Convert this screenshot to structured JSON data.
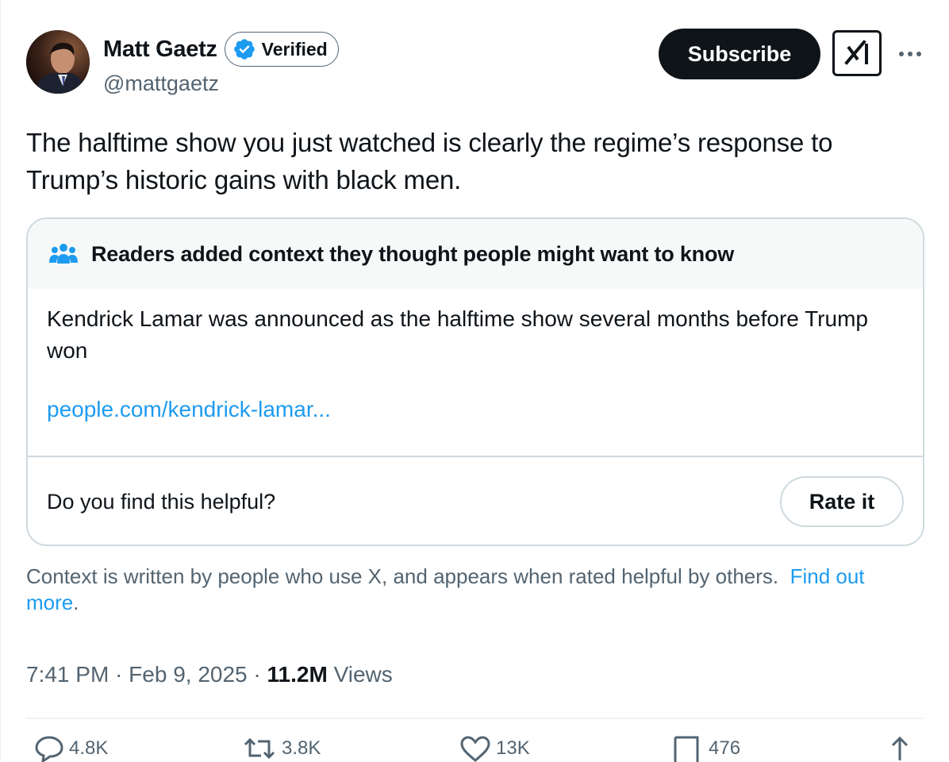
{
  "author": {
    "display_name": "Matt Gaetz",
    "verified_label": "Verified",
    "handle": "@mattgaetz"
  },
  "header_actions": {
    "subscribe_label": "Subscribe",
    "grok_icon": "grok-icon",
    "more_icon": "more-icon"
  },
  "tweet": {
    "text": "The halftime show you just watched is clearly the regime’s response to Trump’s historic gains with black men."
  },
  "community_note": {
    "title": "Readers added context they thought people might want to know",
    "body": "Kendrick Lamar was announced as the halftime show several months before Trump won",
    "link": "people.com/kendrick-lamar...",
    "helpful_question": "Do you find this helpful?",
    "rate_label": "Rate it"
  },
  "context_info": {
    "text": "Context is written by people who use X, and appears when rated helpful by others.",
    "link": "Find out more",
    "period": "."
  },
  "meta": {
    "time": "7:41 PM",
    "sep1": " · ",
    "date": "Feb 9, 2025",
    "sep2": " · ",
    "views_count": "11.2M",
    "views_label": " Views"
  },
  "actions": {
    "replies": "4.8K",
    "reposts": "3.8K",
    "likes": "13K",
    "bookmarks": "476"
  },
  "colors": {
    "accent": "#1d9bf0",
    "text": "#0f1419",
    "secondary": "#536471",
    "border": "#cfd9de"
  }
}
